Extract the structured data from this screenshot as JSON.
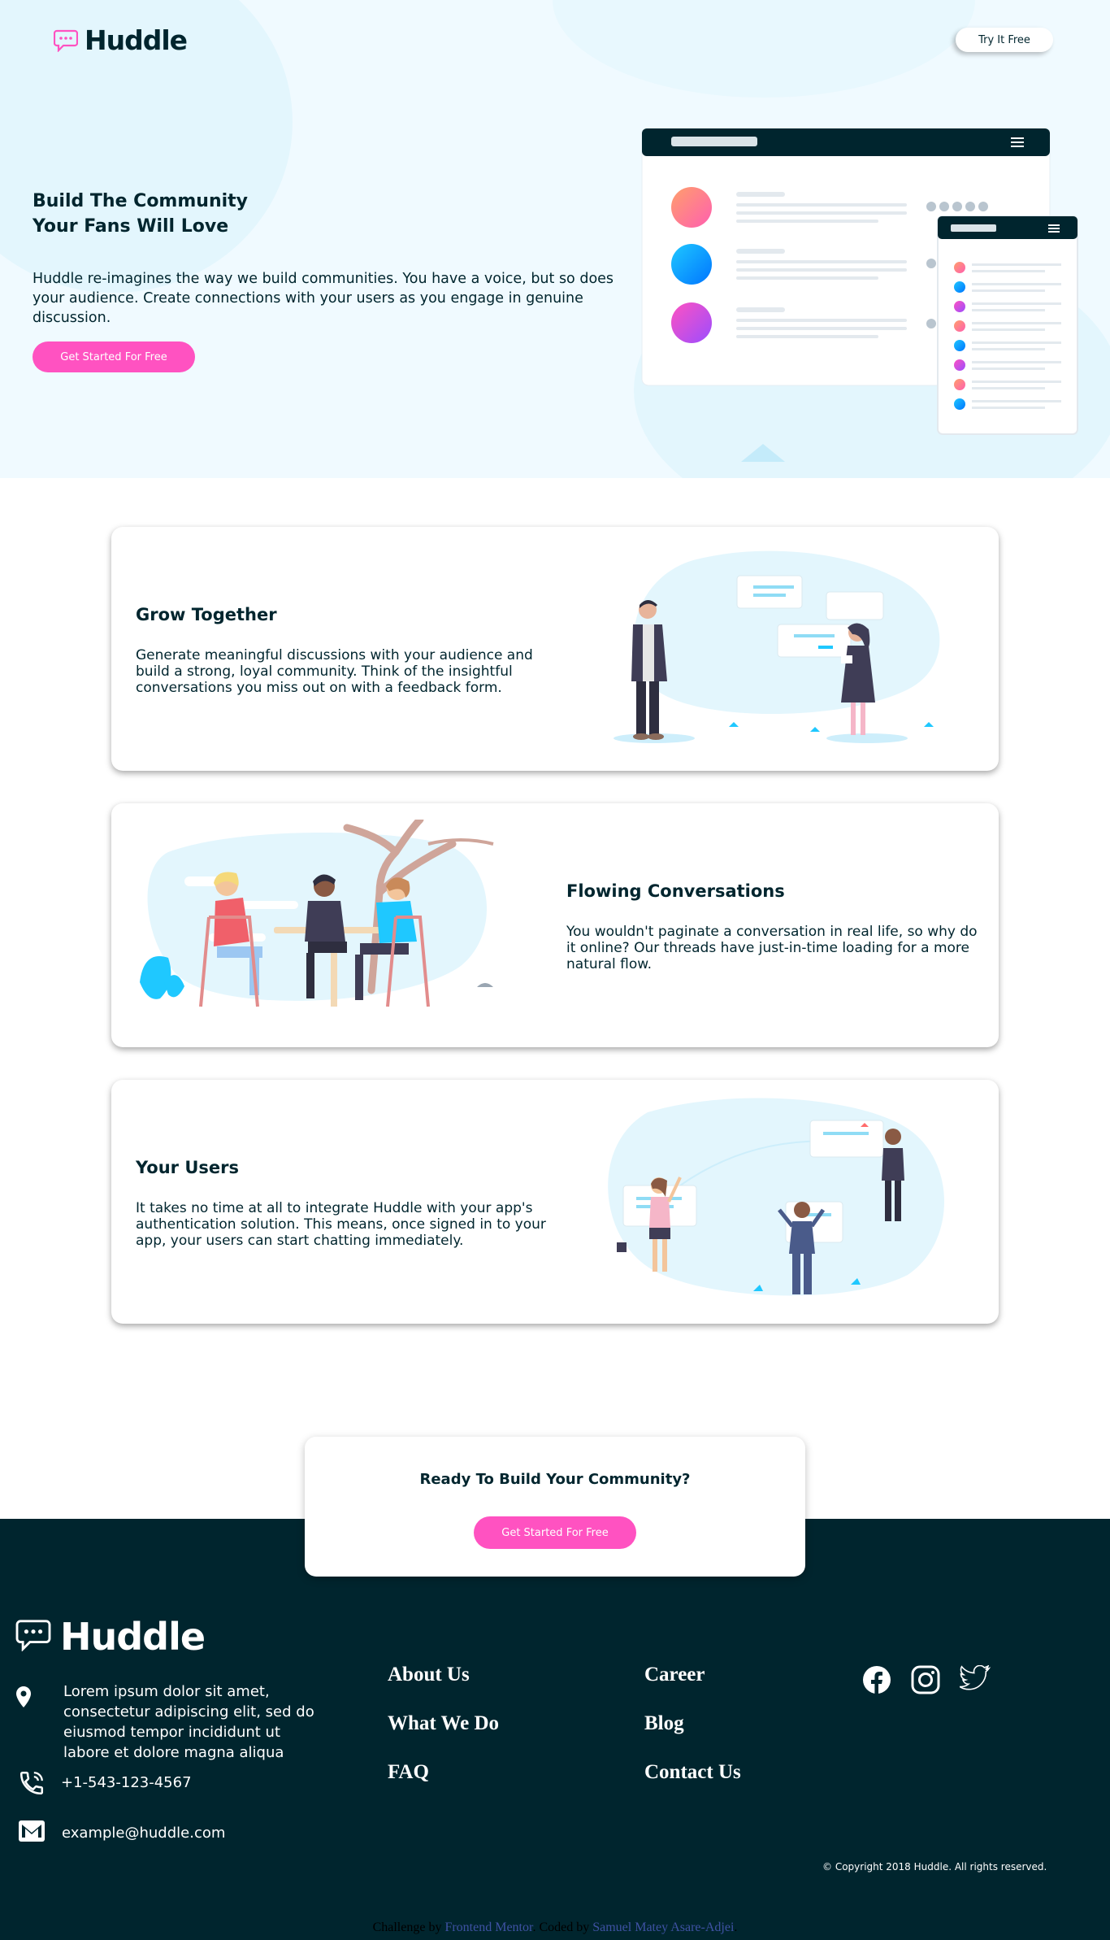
{
  "header": {
    "logo_text": "Huddle",
    "cta_label": "Try It Free"
  },
  "hero": {
    "title_line1": "Build The Community",
    "title_line2": "Your Fans Will Love",
    "description": "Huddle re-imagines the way we build communities. You have a voice, but so does your audience. Create connections with your users as you engage in genuine discussion.",
    "button_label": "Get Started For Free"
  },
  "features": [
    {
      "title": "Grow Together",
      "description": "Generate meaningful discussions with your audience and build a strong, loyal community. Think of the insightful conversations you miss out on with a feedback form."
    },
    {
      "title": "Flowing Conversations",
      "description": "You wouldn't paginate a conversation in real life, so why do it online? Our threads have just-in-time loading for a more natural flow."
    },
    {
      "title": "Your Users",
      "description": "It takes no time at all to integrate Huddle with your app's authentication solution. This means, once signed in to your app, your users can start chatting immediately."
    }
  ],
  "cta": {
    "title": "Ready To Build Your Community?",
    "button_label": "Get Started For Free"
  },
  "footer": {
    "logo_text": "Huddle",
    "address": "Lorem ipsum dolor sit amet, consectetur adipiscing elit, sed do eiusmod tempor incididunt ut labore et dolore magna aliqua",
    "phone": "+1-543-123-4567",
    "email": "example@huddle.com",
    "links_col1": [
      "About Us",
      "What We Do",
      "FAQ"
    ],
    "links_col2": [
      "Career",
      "Blog",
      "Contact Us"
    ],
    "social_icons": [
      "facebook-icon",
      "instagram-icon",
      "twitter-icon"
    ],
    "copyright": "© Copyright 2018 Huddle. All rights reserved."
  },
  "attribution": {
    "prefix": "Challenge by",
    "challenge_link": "Frontend Mentor",
    "middle": ". Coded by",
    "author_link": "Samuel Matey Asare-Adjei",
    "suffix": "."
  },
  "colors": {
    "dark": "#00252e",
    "pink": "#ff52c1",
    "hero_bg": "#f0faff"
  }
}
